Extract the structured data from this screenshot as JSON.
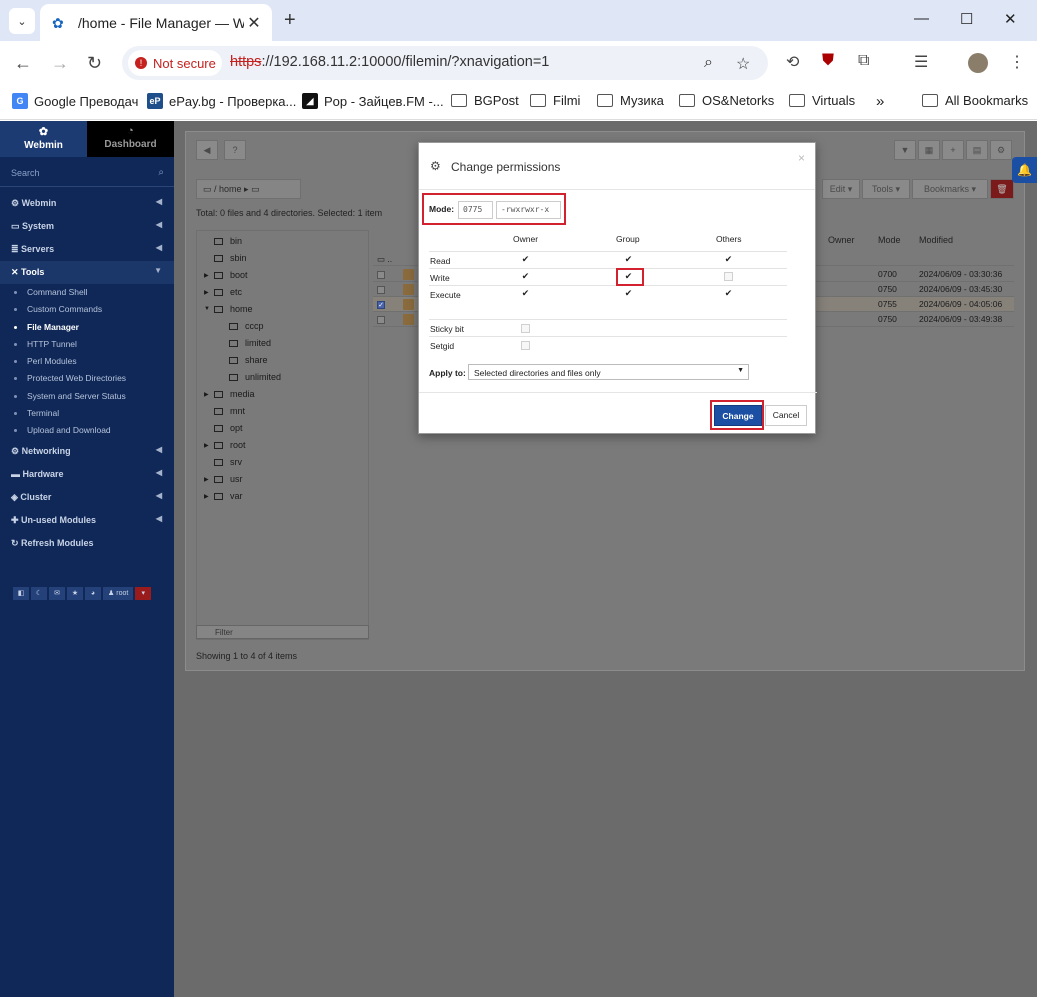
{
  "browser": {
    "tab_title": "/home - File Manager — Webm",
    "security_chip": "Not secure",
    "url_scheme": "https",
    "url_rest": "://192.168.11.2:10000/filemin/?xnavigation=1"
  },
  "bookmarks": [
    {
      "label": "Google Преводач",
      "icon": "google-translate-icon"
    },
    {
      "label": "ePay.bg - Проверка...",
      "icon": "epay-icon"
    },
    {
      "label": "Pop - Зайцев.FM -...",
      "icon": "zaycev-icon"
    },
    {
      "label": "BGPost",
      "icon": "folder-icon"
    },
    {
      "label": "Filmi",
      "icon": "folder-icon"
    },
    {
      "label": "Музика",
      "icon": "folder-icon"
    },
    {
      "label": "OS&Netorks",
      "icon": "folder-icon"
    },
    {
      "label": "Virtuals",
      "icon": "folder-icon"
    }
  ],
  "all_bookmarks": "All Bookmarks",
  "sidebar": {
    "tab_webmin": "Webmin",
    "tab_dashboard": "Dashboard",
    "search_placeholder": "Search",
    "items": [
      "Webmin",
      "System",
      "Servers",
      "Tools"
    ],
    "tools_sub": [
      "Command Shell",
      "Custom Commands",
      "File Manager",
      "HTTP Tunnel",
      "Perl Modules",
      "Protected Web Directories",
      "System and Server Status",
      "Terminal",
      "Upload and Download"
    ],
    "items2": [
      "Networking",
      "Hardware",
      "Cluster",
      "Un-used Modules",
      "Refresh Modules"
    ],
    "user": "root"
  },
  "filemanager": {
    "crumb": "home",
    "total": "Total: 0 files and 4 directories. Selected: 1 item",
    "menu": {
      "edit": "Edit",
      "tools": "Tools",
      "bookmarks": "Bookmarks"
    },
    "tree": [
      {
        "name": "bin",
        "level": 1,
        "arrow": false
      },
      {
        "name": "sbin",
        "level": 1,
        "arrow": false
      },
      {
        "name": "boot",
        "level": 1,
        "arrow": true
      },
      {
        "name": "etc",
        "level": 1,
        "arrow": true
      },
      {
        "name": "home",
        "level": 1,
        "arrow": true,
        "open": true
      },
      {
        "name": "cccp",
        "level": 2,
        "arrow": false
      },
      {
        "name": "limited",
        "level": 2,
        "arrow": false
      },
      {
        "name": "share",
        "level": 2,
        "arrow": false
      },
      {
        "name": "unlimited",
        "level": 2,
        "arrow": false
      },
      {
        "name": "media",
        "level": 1,
        "arrow": true
      },
      {
        "name": "mnt",
        "level": 1,
        "arrow": false
      },
      {
        "name": "opt",
        "level": 1,
        "arrow": false
      },
      {
        "name": "root",
        "level": 1,
        "arrow": true
      },
      {
        "name": "srv",
        "level": 1,
        "arrow": false
      },
      {
        "name": "usr",
        "level": 1,
        "arrow": true
      },
      {
        "name": "var",
        "level": 1,
        "arrow": true
      }
    ],
    "filter_placeholder": "Filter",
    "columns": {
      "owner": "Owner",
      "mode": "Mode",
      "modified": "Modified"
    },
    "rows": [
      {
        "mode": "0700",
        "modified": "2024/06/09 - 03:30:36",
        "selected": false
      },
      {
        "mode": "0750",
        "modified": "2024/06/09 - 03:45:30",
        "selected": false
      },
      {
        "mode": "0755",
        "modified": "2024/06/09 - 04:05:06",
        "selected": true
      },
      {
        "mode": "0750",
        "modified": "2024/06/09 - 03:49:38",
        "selected": false
      }
    ],
    "showing": "Showing 1 to 4 of 4 items"
  },
  "modal": {
    "title": "Change permissions",
    "mode_label": "Mode:",
    "mode_octal": "0775",
    "mode_symbolic": "-rwxrwxr-x",
    "col_owner": "Owner",
    "col_group": "Group",
    "col_others": "Others",
    "rows": [
      {
        "label": "Read",
        "owner": true,
        "group": true,
        "others": true
      },
      {
        "label": "Write",
        "owner": true,
        "group": true,
        "others": false
      },
      {
        "label": "Execute",
        "owner": true,
        "group": true,
        "others": true
      }
    ],
    "sticky_label": "Sticky bit",
    "setgid_label": "Setgid",
    "apply_label": "Apply to:",
    "apply_value": "Selected directories and files only",
    "change_label": "Change",
    "cancel_label": "Cancel"
  },
  "colors": {
    "accent": "#1b4fa3",
    "highlight": "#d3222f",
    "sidebar": "#0f2858"
  }
}
